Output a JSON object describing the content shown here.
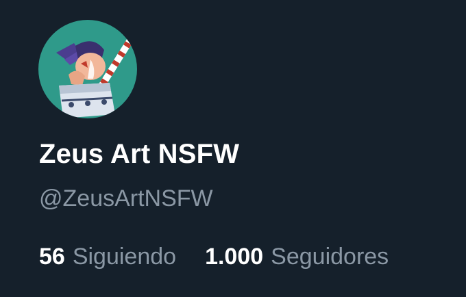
{
  "profile": {
    "display_name": "Zeus Art NSFW",
    "handle": "@ZeusArtNSFW",
    "avatar_icon": "avatar-illustration",
    "stats": {
      "following_count": "56",
      "following_label": "Siguiendo",
      "followers_count": "1.000",
      "followers_label": "Seguidores"
    }
  },
  "colors": {
    "background": "#15202b",
    "primary_text": "#ffffff",
    "secondary_text": "#8b98a5",
    "avatar_bg": "#2f9a8a"
  }
}
